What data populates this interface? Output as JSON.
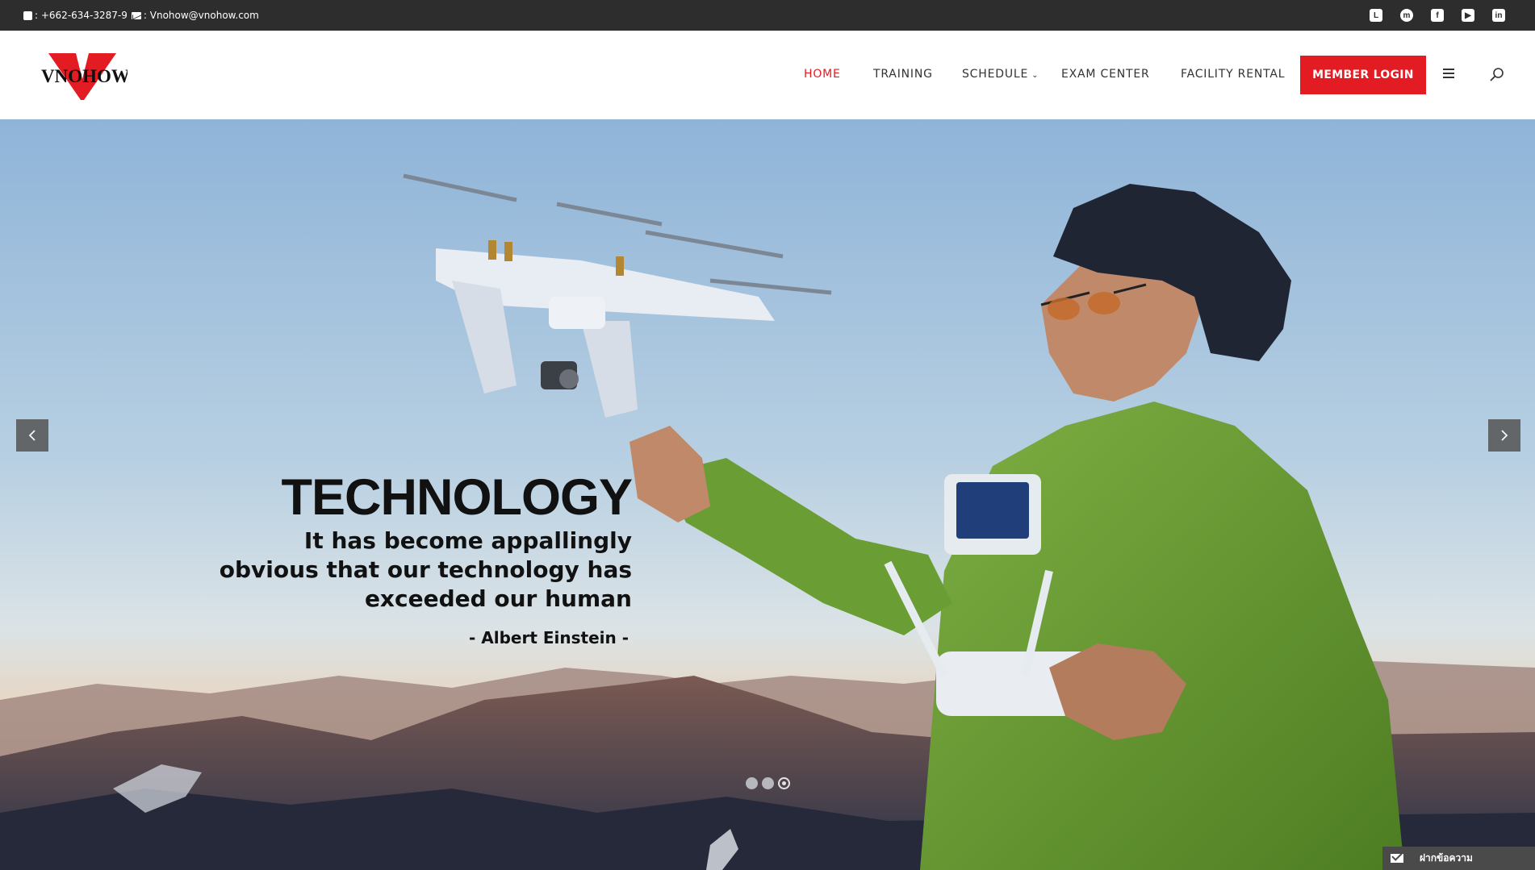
{
  "topbar": {
    "phone": ": +662-634-3287-9",
    "email": ": Vnohow@vnohow.com",
    "social_icons": [
      "line-icon",
      "messenger-icon",
      "facebook-icon",
      "youtube-icon",
      "linkedin-icon"
    ]
  },
  "header": {
    "logo_text": "VNOHOW",
    "nav": [
      {
        "label": "HOME",
        "active": true
      },
      {
        "label": "TRAINING",
        "active": false
      },
      {
        "label": "SCHEDULE",
        "active": false,
        "has_dropdown": true
      },
      {
        "label": "EXAM CENTER",
        "active": false
      },
      {
        "label": "FACILITY RENTAL",
        "active": false
      }
    ],
    "login_label": "MEMBER LOGIN"
  },
  "hero": {
    "title": "TECHNOLOGY",
    "quote": "It has become appallingly obvious that our technology has exceeded our human",
    "author": "- Albert Einstein -",
    "slide_count": 3,
    "active_slide": 3
  },
  "message_tab": {
    "label": "ฝากข้อความ"
  },
  "colors": {
    "accent": "#e31b23",
    "topbar_bg": "#2d2d2d",
    "text_dark": "#333333"
  }
}
